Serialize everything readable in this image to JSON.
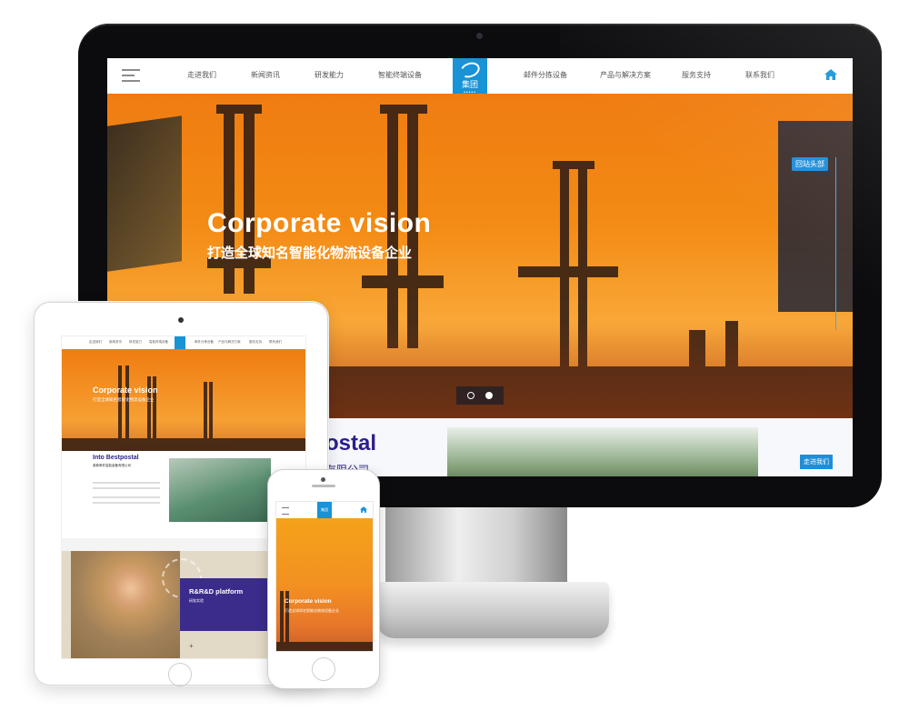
{
  "desktop": {
    "nav": {
      "items": [
        "走进我们",
        "新闻资讯",
        "研发能力",
        "智能终端设备",
        "邮件分拣设备",
        "产品与解决方案",
        "服务支持",
        "联系我们"
      ],
      "logo_text": "集团",
      "logo_dots": "•••••"
    },
    "hero": {
      "title": "Corporate vision",
      "subtitle": "打造全球知名智能化物流设备企业",
      "side_tag": "回站头部"
    },
    "below": {
      "heading": "ostal",
      "sub": "有限公司",
      "button": "走进我们"
    }
  },
  "tablet": {
    "nav_items": [
      "走进我们",
      "新闻资讯",
      "研发能力",
      "智能终端设备",
      "邮件分拣设备",
      "产品与解决方案",
      "服务支持",
      "联系我们"
    ],
    "hero": {
      "title": "Corporate vision",
      "subtitle": "打造全球知名智能化物流设备企业"
    },
    "info": {
      "heading": "Into Bestpostal",
      "sub": "莱斯邮件智能装备有限公司"
    },
    "rd": {
      "heading": "R&R&D platform",
      "sub": "研发实验",
      "plus": "+"
    }
  },
  "phone": {
    "logo_text": "集团",
    "hero": {
      "title": "Corporate vision",
      "subtitle": "打造全球知名智能化物流设备企业"
    }
  },
  "colors": {
    "brand_blue": "#1793d6",
    "hero_orange": "#f38b14",
    "purple": "#3b2c8c"
  }
}
